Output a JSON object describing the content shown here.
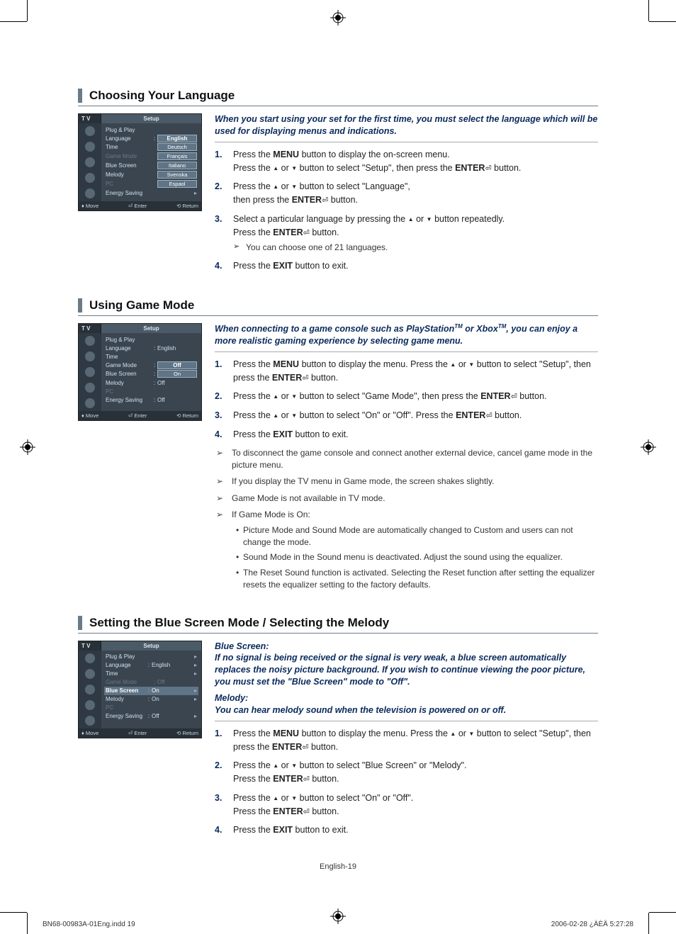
{
  "page": {
    "number_label": "English-19",
    "footer_file": "BN68-00983A-01Eng.indd   19",
    "footer_date": "2006-02-28   ¿ÀÈÄ 5:27:28"
  },
  "osd_common": {
    "tv": "T V",
    "title": "Setup",
    "foot_move": "Move",
    "foot_enter": "Enter",
    "foot_return": "Return"
  },
  "osd1": {
    "rows": {
      "plugplay": "Plug & Play",
      "language": "Language",
      "time": "Time",
      "gamemode": "Game Mode",
      "bluescreen": "Blue Screen",
      "melody": "Melody",
      "pc": "PC",
      "energy": "Energy Saving"
    },
    "langs": [
      "English",
      "Deutsch",
      "Français",
      "Italiano",
      "Svenska",
      "Espaol"
    ]
  },
  "osd2": {
    "vals": {
      "language": "English",
      "gamemode_off": "Off",
      "gamemode_on": "On",
      "melody": "Off",
      "energy": "Off"
    }
  },
  "osd3": {
    "vals": {
      "language": "English",
      "gamemode": "Off",
      "bluescreen": "On",
      "melody": "On",
      "energy": "Off"
    }
  },
  "s1": {
    "title": "Choosing Your Language",
    "intro": "When you start using your set for the first time, you must select the language which will be used for displaying menus and indications.",
    "step1a": "Press the ",
    "step1b": " button to display the on-screen menu.",
    "step1c": "Press the ",
    "step1d": " button to select \"Setup\", then press the ",
    "step1e": " button.",
    "step2a": "Press the ",
    "step2b": " button to select \"Language\",",
    "step2c": "then press the ",
    "step2d": " button.",
    "step3a": "Select a particular language by pressing the ",
    "step3b": " button repeatedly.",
    "step3c": "Press the ",
    "step3d": " button.",
    "step3note": "You can choose one of 21 languages.",
    "step4a": "Press the ",
    "step4b": " button to exit.",
    "menu": "MENU",
    "enter": "ENTER",
    "exit": "EXIT",
    "or": " or "
  },
  "s2": {
    "title": "Using Game Mode",
    "intro_a": "When connecting to a game console such as PlayStation",
    "intro_b": " or Xbox",
    "intro_c": ", you can enjoy a more realistic gaming experience by selecting game menu.",
    "step1a": "Press the ",
    "step1b": " button to display the menu. Press the ",
    "step1c": " button to select \"Setup\", then press the ",
    "step1d": " button.",
    "step2a": "Press the ",
    "step2b": " button to select \"Game Mode\", then press the ",
    "step2c": " button.",
    "step3a": "Press the ",
    "step3b": " button to select \"On\" or \"Off\". Press the ",
    "step3c": " button.",
    "step4a": "Press the ",
    "step4b": " button to exit.",
    "note1": "To disconnect the game console and connect another external device, cancel game mode in the picture menu.",
    "note2": "If you display the TV menu in Game mode, the screen shakes slightly.",
    "note3": "Game Mode is not available in TV mode.",
    "note4": "If Game Mode is On:",
    "note4_b1": "Picture Mode and Sound Mode are automatically changed to Custom and users can not change the mode.",
    "note4_b2": "Sound Mode in the Sound menu is deactivated. Adjust the sound using the equalizer.",
    "note4_b3": "The Reset Sound function is activated. Selecting the Reset function after setting the equalizer resets the equalizer setting to the factory defaults."
  },
  "s3": {
    "title": "Setting the Blue Screen Mode / Selecting the Melody",
    "blue_label": "Blue Screen:",
    "blue_intro": "If no signal is being received or the signal is very weak, a blue screen automatically replaces the noisy picture background. If you wish to continue viewing the poor picture, you must set the \"Blue Screen\" mode to \"Off\".",
    "melody_label": "Melody:",
    "melody_intro": "You can hear melody sound when the television is powered on or off.",
    "step1a": "Press the ",
    "step1b": " button to display the menu. Press the ",
    "step1c": " button to select \"Setup\", then press the ",
    "step1d": " button.",
    "step2a": "Press the ",
    "step2b": " button to select \"Blue Screen\" or \"Melody\".",
    "step2c": "Press the ",
    "step2d": " button.",
    "step3a": "Press the ",
    "step3b": " button to select \"On\" or \"Off\".",
    "step3c": "Press the ",
    "step3d": " button.",
    "step4a": "Press the ",
    "step4b": " button to exit."
  }
}
